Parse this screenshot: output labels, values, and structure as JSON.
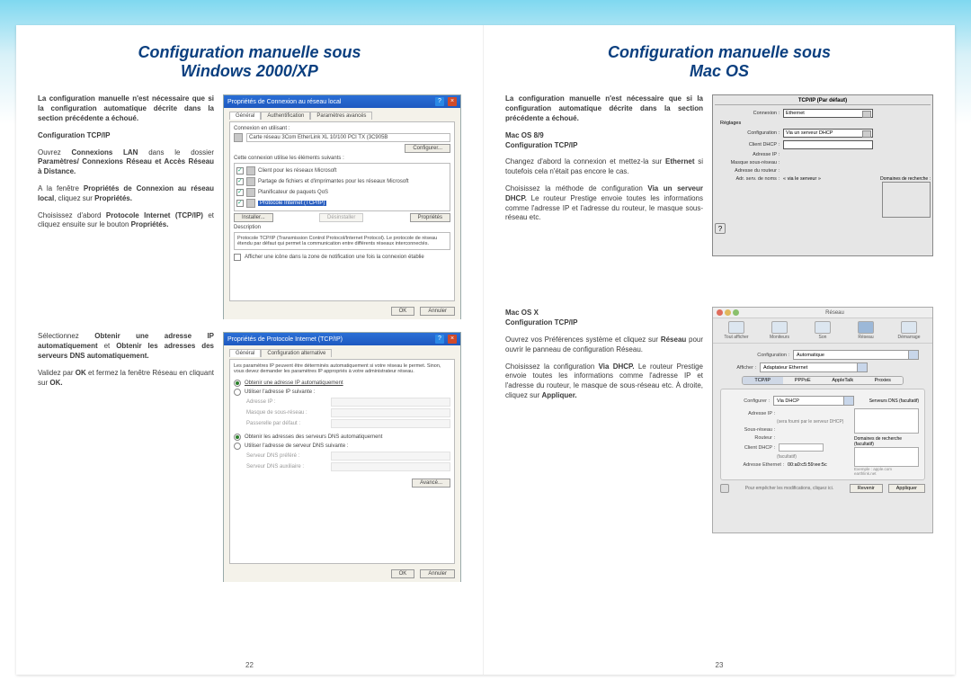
{
  "left": {
    "title_l1": "Configuration manuelle sous",
    "title_l2": "Windows 2000/XP",
    "intro": "La configuration manuelle n'est nécessaire que si la configuration automatique décrite dans la section précédente a échoué.",
    "h_tcpip": "Configuration TCP/IP",
    "p1_a": "Ouvrez ",
    "p1_b": "Connexions LAN",
    "p1_c": " dans le dossier ",
    "p1_d": "Paramètres/ Connexions Réseau et Accès Réseau à Distance.",
    "p2_a": "A la fenêtre ",
    "p2_b": "Propriétés de Connexion au réseau local",
    "p2_c": ", cliquez sur ",
    "p2_d": "Propriétés.",
    "p3_a": "Choisissez d'abord ",
    "p3_b": "Protocole Internet (TCP/IP)",
    "p3_c": " et cliquez ensuite sur le bouton ",
    "p3_d": "Propriétés.",
    "p4_a": "Sélectionnez ",
    "p4_b": "Obtenir une adresse IP automatiquement",
    "p4_c": " et ",
    "p4_d": "Obtenir les adresses des serveurs DNS automatiquement.",
    "p5_a": "Validez par ",
    "p5_b": "OK",
    "p5_c": " et fermez la fenêtre Réseau en cliquant sur ",
    "p5_d": "OK.",
    "page_num": "22",
    "xp1": {
      "title": "Propriétés de Connexion au réseau local",
      "tab1": "Général",
      "tab2": "Authentification",
      "tab3": "Paramètres avancés",
      "conn_label": "Connexion en utilisant :",
      "adapter": "Carte réseau 3Com EtherLink XL 10/100 PCI TX (3C905B",
      "configure": "Configurer...",
      "uses_label": "Cette connexion utilise les éléments suivants :",
      "item1": "Client pour les réseaux Microsoft",
      "item2": "Partage de fichiers et d'imprimantes pour les réseaux Microsoft",
      "item3": "Planificateur de paquets QoS",
      "item4": "Protocole Internet (TCP/IP)",
      "install": "Installer...",
      "uninstall": "Désinstaller",
      "props": "Propriétés",
      "desc_h": "Description",
      "desc": "Protocole TCP/IP (Transmission Control Protocol/Internet Protocol). Le protocole de réseau étendu par défaut qui permet la communication entre différents réseaux interconnectés.",
      "chk_notify": "Afficher une icône dans la zone de notification une fois la connexion établie",
      "ok": "OK",
      "cancel": "Annuler"
    },
    "xp2": {
      "title": "Propriétés de Protocole Internet (TCP/IP)",
      "tab1": "Général",
      "tab2": "Configuration alternative",
      "intro": "Les paramètres IP peuvent être déterminés automatiquement si votre réseau le permet. Sinon, vous devez demander les paramètres IP appropriés à votre administrateur réseau.",
      "r1": "Obtenir une adresse IP automatiquement",
      "r2": "Utiliser l'adresse IP suivante :",
      "l_ip": "Adresse IP :",
      "l_mask": "Masque de sous-réseau :",
      "l_gw": "Passerelle par défaut :",
      "r3": "Obtenir les adresses des serveurs DNS automatiquement",
      "r4": "Utiliser l'adresse de serveur DNS suivante :",
      "l_dns1": "Serveur DNS préféré :",
      "l_dns2": "Serveur DNS auxiliaire :",
      "adv": "Avancé...",
      "ok": "OK",
      "cancel": "Annuler"
    }
  },
  "right": {
    "title_l1": "Configuration manuelle sous",
    "title_l2": "Mac OS",
    "intro": "La configuration manuelle n'est nécessaire que si la configuration automatique décrite dans la section précédente a échoué.",
    "h_89_a": "Mac OS 8/9",
    "h_89_b": "Configuration TCP/IP",
    "p1_a": "Changez d'abord la connexion et mettez-la sur ",
    "p1_b": "Ethernet",
    "p1_c": " si toutefois cela n'était pas encore le cas.",
    "p2_a": "Choisissez la méthode de configuration ",
    "p2_b": "Via un serveur DHCP.",
    "p2_c": " Le routeur Prestige envoie toutes les informations comme l'adresse IP et l'adresse du routeur, le masque sous-réseau etc.",
    "h_x_a": "Mac OS X",
    "h_x_b": "Configuration TCP/IP",
    "p3_a": "Ouvrez vos Préférences système et cliquez sur ",
    "p3_b": "Réseau",
    "p3_c": " pour ouvrir le panneau de configuration Réseau.",
    "p4_a": "Choisissez la configuration ",
    "p4_b": "Via DHCP.",
    "p4_c": " Le routeur Prestige envoie toutes les informations comme l'adresse IP et l'adresse du routeur, le masque de sous-réseau etc. À droite, cliquez sur ",
    "p4_d": "Appliquer.",
    "page_num": "23",
    "mac9": {
      "title": "TCP/IP (Par défaut)",
      "l_conn": "Connexion :",
      "v_conn": "Ethernet",
      "grp": "Réglages",
      "l_cfg": "Configuration :",
      "v_cfg": "Via un serveur DHCP",
      "l_client": "Client DHCP :",
      "l_ip": "Adresse IP :",
      "l_mask": "Masque sous-réseau :",
      "l_router": "Adresse du routeur :",
      "l_dns": "Adr. serv. de noms :",
      "v_dns": "« via le serveur »",
      "l_search": "Domaines de recherche :"
    },
    "osx": {
      "title": "Réseau",
      "tb1": "Tout afficher",
      "tb2": "Moniteurs",
      "tb3": "Son",
      "tb4": "Réseau",
      "tb5": "Démarrage",
      "l_cfg": "Configuration :",
      "v_cfg": "Automatique",
      "l_show": "Afficher :",
      "v_show": "Adaptateur Ethernet",
      "tab1": "TCP/IP",
      "tab2": "PPPoE",
      "tab3": "AppleTalk",
      "tab4": "Proxies",
      "l_conf": "Configurer :",
      "v_conf": "Via DHCP",
      "l_dns": "Serveurs DNS",
      "l_opt": "(facultatif)",
      "l_ip": "Adresse IP :",
      "v_ipnote": "(sera fourni par le serveur DHCP)",
      "l_mask": "Sous-réseau :",
      "l_router": "Routeur :",
      "l_search": "Domaines de recherche (facultatif)",
      "l_dhcp": "Client DHCP :",
      "v_dhcpnote": "(facultatif)",
      "l_eth": "Adresse Ethernet :",
      "v_eth": "00:a0:c5:59:ee:5c",
      "ex": "Exemple : apple.com\nearthlink.net",
      "lock": "Pour empêcher les modifications, cliquez ici.",
      "b_revert": "Revenir",
      "b_apply": "Appliquer"
    }
  }
}
